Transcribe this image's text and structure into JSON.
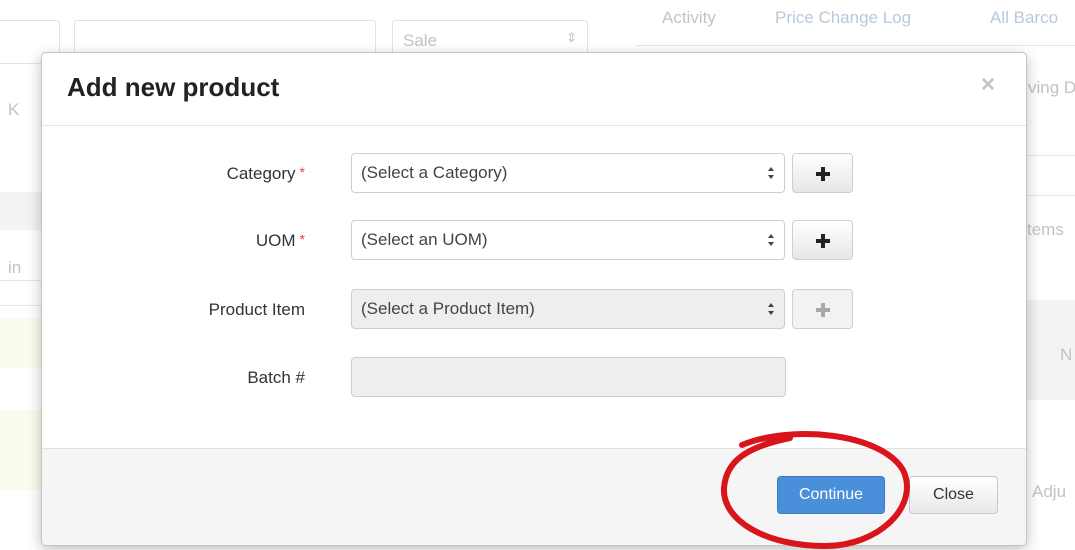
{
  "background": {
    "sale_select": "Sale",
    "tab_activity": "Activity",
    "tab_price_change_log": "Price Change Log",
    "tab_all_barcodes": "All Barco",
    "frag_ving": "ving D",
    "frag_left_x": "K",
    "frag_in": "in",
    "frag_items": "tems",
    "frag_n": "N",
    "frag_adju": "Adju"
  },
  "modal": {
    "title": "Add new product",
    "close_icon": "×",
    "fields": {
      "category": {
        "label": "Category",
        "required_mark": "*",
        "value": "(Select a Category)"
      },
      "uom": {
        "label": "UOM",
        "required_mark": "*",
        "value": "(Select an UOM)"
      },
      "product_item": {
        "label": "Product Item",
        "value": "(Select a Product Item)"
      },
      "batch": {
        "label": "Batch #",
        "value": ""
      }
    },
    "footer": {
      "continue_label": "Continue",
      "close_label": "Close"
    }
  },
  "colors": {
    "primary_button": "#4a8fd9",
    "annotation_circle": "#d9141a",
    "required_star": "#e04040"
  }
}
